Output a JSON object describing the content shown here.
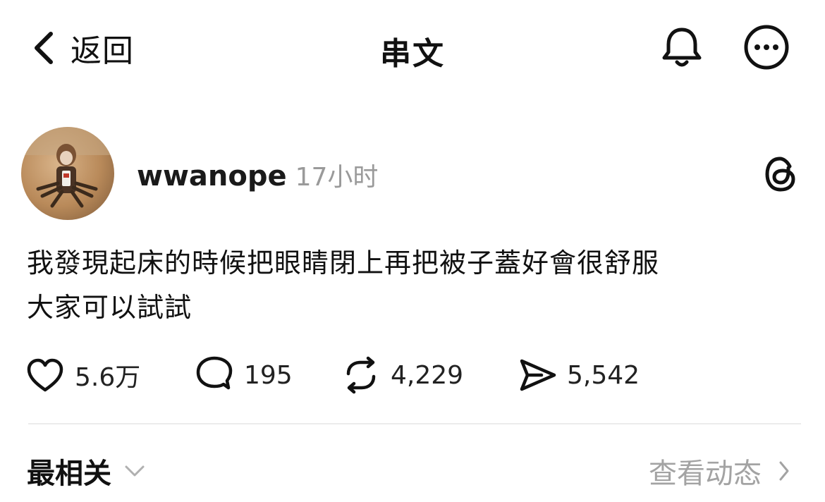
{
  "header": {
    "back_label": "返回",
    "title": "串文"
  },
  "post": {
    "username": "wwanope",
    "time": "17小时",
    "body_lines": [
      "我發現起床的時候把眼睛閉上再把被子蓋好會很舒服",
      "大家可以試試"
    ]
  },
  "actions": {
    "likes": "5.6万",
    "comments": "195",
    "reposts": "4,229",
    "shares": "5,542"
  },
  "footer": {
    "sort_label": "最相关",
    "activity_label": "查看动态"
  },
  "icons": {
    "back": "chevron-left-icon",
    "notifications": "bell-icon",
    "more": "more-icon",
    "threads": "threads-logo-icon",
    "like": "heart-icon",
    "comment": "comment-icon",
    "repost": "repost-icon",
    "share": "send-icon",
    "sort_chevron": "chevron-down-icon",
    "activity_chevron": "chevron-right-icon"
  }
}
